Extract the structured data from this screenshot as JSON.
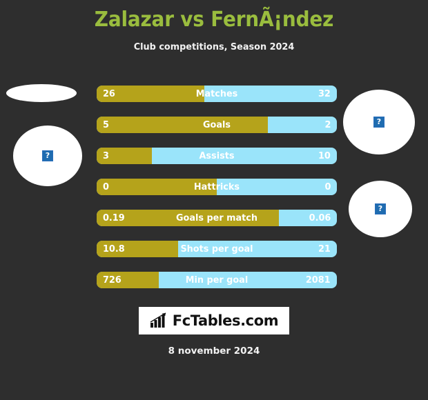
{
  "header": {
    "title": "Zalazar vs FernÃ¡ndez",
    "subtitle": "Club competitions, Season 2024",
    "title_color": "#9abd3e"
  },
  "theme": {
    "background": "#2e2e2e",
    "home_color": "#b5a31b",
    "away_color": "#9ae4fa",
    "text_color": "#ffffff"
  },
  "crests": {
    "home_top": {
      "placeholder": "?"
    },
    "home_main": {
      "placeholder": "?"
    },
    "away_top": {
      "placeholder": "?"
    },
    "away_main": {
      "placeholder": "?"
    }
  },
  "chart_data": {
    "type": "bar",
    "title": "Zalazar vs FernÃ¡ndez",
    "subtitle": "Club competitions, Season 2024",
    "orientation": "horizontal-diverging",
    "legend": [
      "Zalazar",
      "FernÃ¡ndez"
    ],
    "categories": [
      "Matches",
      "Goals",
      "Assists",
      "Hattricks",
      "Goals per match",
      "Shots per goal",
      "Min per goal"
    ],
    "series": [
      {
        "name": "Zalazar",
        "color": "#b5a31b",
        "values": [
          26,
          5,
          3,
          0,
          0.19,
          10.8,
          726
        ],
        "labels": [
          "26",
          "5",
          "3",
          "0",
          "0.19",
          "10.8",
          "726"
        ]
      },
      {
        "name": "FernÃ¡ndez",
        "color": "#9ae4fa",
        "values": [
          32,
          2,
          10,
          0,
          0.06,
          21,
          2081
        ],
        "labels": [
          "32",
          "2",
          "10",
          "0",
          "0.06",
          "21",
          "2081"
        ]
      }
    ],
    "fill_percent": [
      44.8,
      71.4,
      23.1,
      50,
      76,
      34,
      25.9
    ]
  },
  "rows": [
    {
      "label": "Matches",
      "left": "26",
      "right": "32",
      "fill": 44.8
    },
    {
      "label": "Goals",
      "left": "5",
      "right": "2",
      "fill": 71.4
    },
    {
      "label": "Assists",
      "left": "3",
      "right": "10",
      "fill": 23.1
    },
    {
      "label": "Hattricks",
      "left": "0",
      "right": "0",
      "fill": 50
    },
    {
      "label": "Goals per match",
      "left": "0.19",
      "right": "0.06",
      "fill": 76
    },
    {
      "label": "Shots per goal",
      "left": "10.8",
      "right": "21",
      "fill": 34
    },
    {
      "label": "Min per goal",
      "left": "726",
      "right": "2081",
      "fill": 25.9
    }
  ],
  "logo": {
    "text": "FcTables.com",
    "icon": "bar-chart-growth-icon"
  },
  "footer": {
    "date": "8 november 2024"
  }
}
